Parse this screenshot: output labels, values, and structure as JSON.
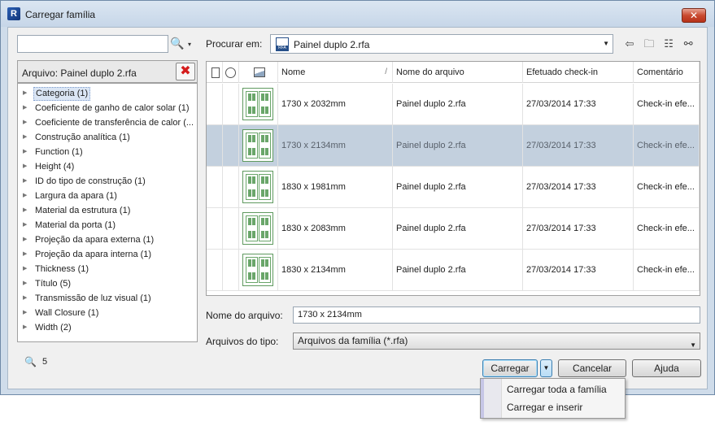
{
  "window": {
    "title": "Carregar família",
    "app_icon_letter": "R",
    "close_glyph": "✕"
  },
  "left_panel": {
    "search": {
      "value": "",
      "placeholder": ""
    },
    "search_icon": "search-icon",
    "file_filter_label": "Arquivo: Painel duplo 2.rfa",
    "clear_glyph": "✖",
    "tree_items": [
      "Categoria (1)",
      "Coeficiente de ganho de calor solar (1)",
      "Coeficiente de transferência de calor (...",
      "Construção analítica (1)",
      "Function (1)",
      "Height (4)",
      "ID do tipo de construção (1)",
      "Largura da apara (1)",
      "Material da estrutura (1)",
      "Material da porta (1)",
      "Projeção da apara externa (1)",
      "Projeção da apara interna (1)",
      "Thickness (1)",
      "Título (5)",
      "Transmissão de luz visual (1)",
      "Wall Closure (1)",
      "Width (2)"
    ],
    "selected_index": 0,
    "result_count": "5"
  },
  "look_in": {
    "label": "Procurar em:",
    "value": "Painel duplo 2.rfa",
    "file_badge": "RFA"
  },
  "toolbar_icons": [
    "back-arrow-icon",
    "folder-up-icon",
    "view-options-icon",
    "binoculars-icon"
  ],
  "grid": {
    "columns": [
      "Nome",
      "Nome do arquivo",
      "Efetuado check-in",
      "Comentário"
    ],
    "rows": [
      {
        "name": "1730 x 2032mm",
        "file": "Painel duplo 2.rfa",
        "checkin": "27/03/2014 17:33",
        "comment": "Check-in efe..."
      },
      {
        "name": "1730 x 2134mm",
        "file": "Painel duplo 2.rfa",
        "checkin": "27/03/2014 17:33",
        "comment": "Check-in efe..."
      },
      {
        "name": "1830 x 1981mm",
        "file": "Painel duplo 2.rfa",
        "checkin": "27/03/2014 17:33",
        "comment": "Check-in efe..."
      },
      {
        "name": "1830 x 2083mm",
        "file": "Painel duplo 2.rfa",
        "checkin": "27/03/2014 17:33",
        "comment": "Check-in efe..."
      },
      {
        "name": "1830 x 2134mm",
        "file": "Painel duplo 2.rfa",
        "checkin": "27/03/2014 17:33",
        "comment": "Check-in efe..."
      }
    ],
    "selected_row": 1
  },
  "file_name": {
    "label": "Nome do arquivo:",
    "value": "1730 x 2134mm"
  },
  "file_type": {
    "label": "Arquivos do tipo:",
    "value": "Arquivos da família (*.rfa)"
  },
  "buttons": {
    "load": "Carregar",
    "cancel": "Cancelar",
    "help": "Ajuda"
  },
  "load_menu": {
    "items": [
      "Carregar toda a família",
      "Carregar e inserir"
    ]
  },
  "colors": {
    "selection": "#c3d0de",
    "title_bar": "#cfdcea",
    "close_button": "#c94a30",
    "accent_blue": "#3c7fb1"
  }
}
